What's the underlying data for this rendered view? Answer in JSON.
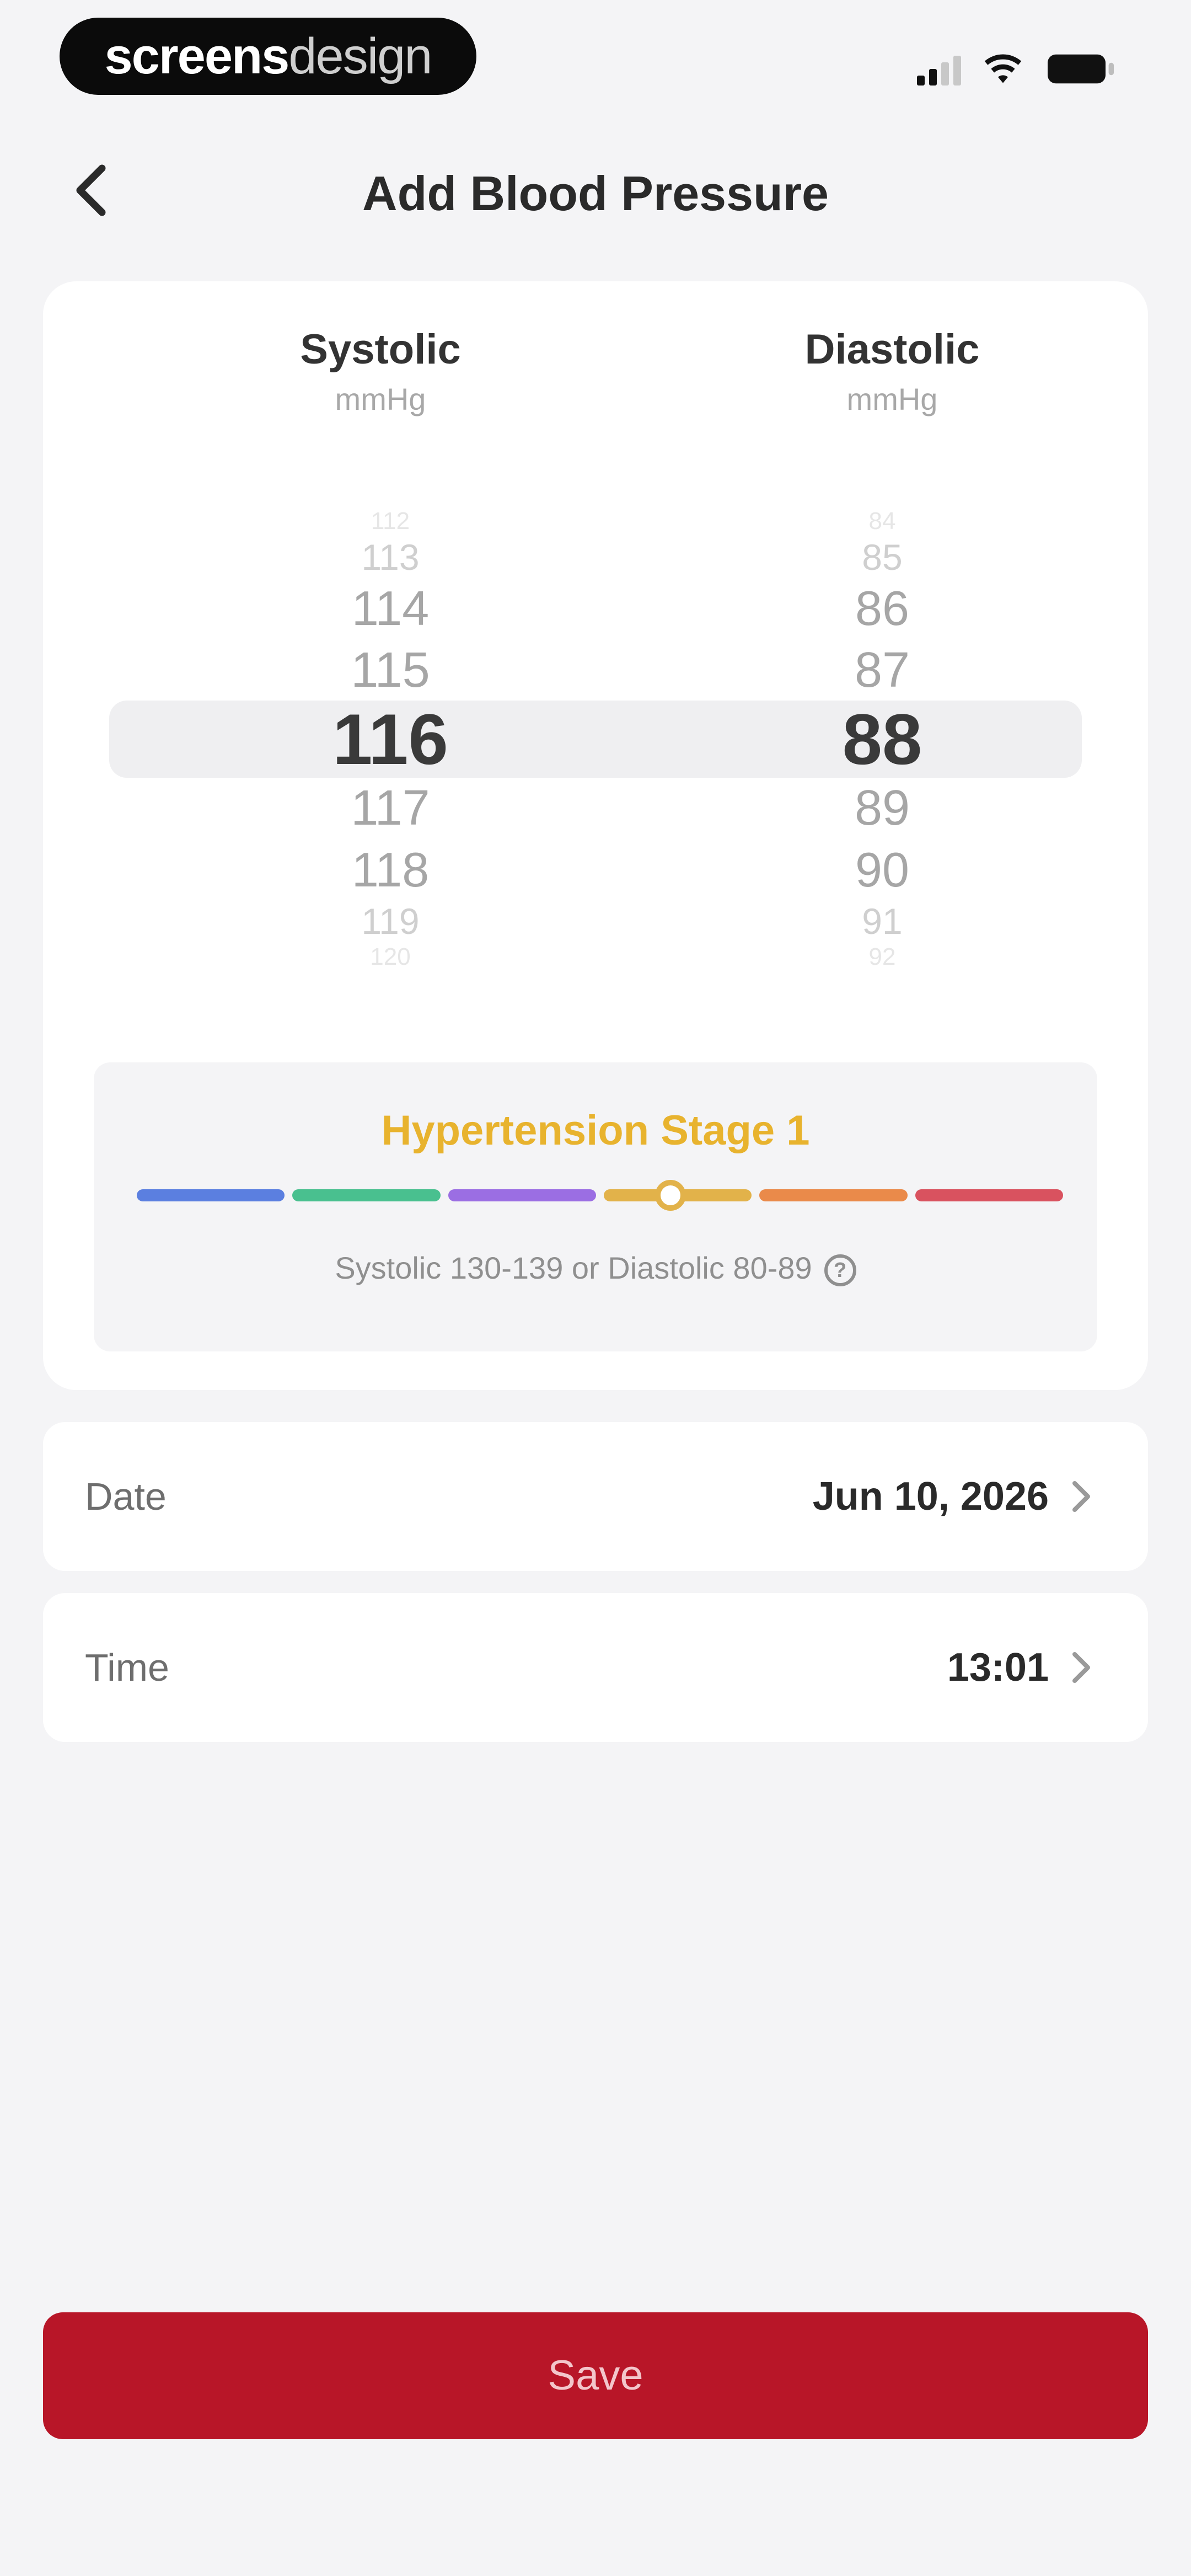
{
  "status_bar": {
    "brand_bold": "screens",
    "brand_light": "design"
  },
  "header": {
    "title": "Add Blood Pressure"
  },
  "picker": {
    "systolic": {
      "label": "Systolic",
      "unit": "mmHg",
      "values": [
        "112",
        "113",
        "114",
        "115",
        "116",
        "117",
        "118",
        "119",
        "120"
      ],
      "selected": "116"
    },
    "diastolic": {
      "label": "Diastolic",
      "unit": "mmHg",
      "values": [
        "84",
        "85",
        "86",
        "87",
        "88",
        "89",
        "90",
        "91",
        "92"
      ],
      "selected": "88"
    }
  },
  "category": {
    "title": "Hypertension Stage 1",
    "description": "Systolic 130-139 or Diastolic 80-89",
    "title_color": "#e8b32e",
    "scale_colors": [
      "#5b7fe0",
      "#49c08f",
      "#9b6ee3",
      "#e2b24a",
      "#ea8a4a",
      "#d9525f"
    ],
    "active_segment_index": 3
  },
  "date_row": {
    "label": "Date",
    "value": "Jun 10, 2026"
  },
  "time_row": {
    "label": "Time",
    "value": "13:01"
  },
  "save_button": {
    "label": "Save",
    "color": "#b81628"
  }
}
